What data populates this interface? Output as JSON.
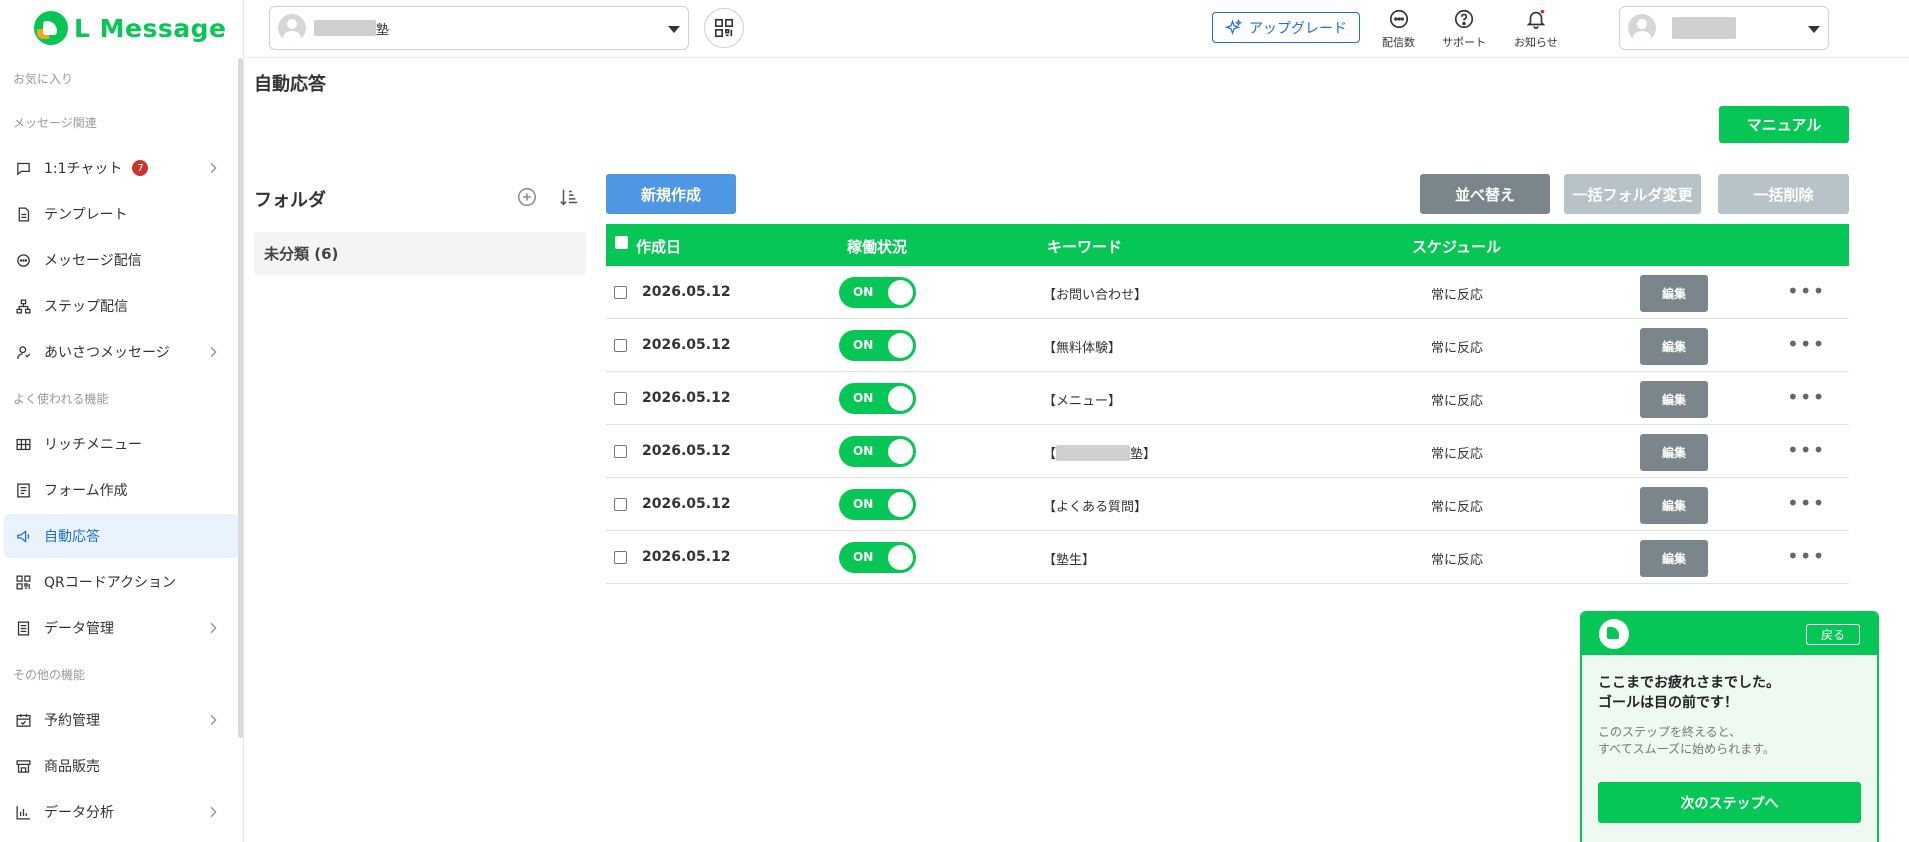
{
  "app": {
    "logo_text": "L Message"
  },
  "sidebar": {
    "sections": {
      "favorites": "お気に入り",
      "message": "メッセージ関連",
      "common": "よく使われる機能",
      "other": "その他の機能"
    },
    "items": {
      "chat": {
        "label": "1:1チャット",
        "badge": "7"
      },
      "template": {
        "label": "テンプレート"
      },
      "broadcast": {
        "label": "メッセージ配信"
      },
      "step": {
        "label": "ステップ配信"
      },
      "greeting": {
        "label": "あいさつメッセージ"
      },
      "richmenu": {
        "label": "リッチメニュー"
      },
      "form": {
        "label": "フォーム作成"
      },
      "autoreply": {
        "label": "自動応答"
      },
      "qr": {
        "label": "QRコードアクション"
      },
      "data": {
        "label": "データ管理"
      },
      "reservation": {
        "label": "予約管理"
      },
      "sales": {
        "label": "商品販売"
      },
      "analytics": {
        "label": "データ分析"
      }
    }
  },
  "header": {
    "account_suffix": "塾",
    "upgrade_label": "アップグレード",
    "icons": {
      "deliveries": "配信数",
      "support": "サポート",
      "notifications": "お知らせ"
    }
  },
  "main": {
    "title": "自動応答",
    "manual_label": "マニュアル",
    "folder": {
      "title": "フォルダ",
      "item_label": "未分類 (6)"
    },
    "toolbar": {
      "new_label": "新規作成",
      "sort_label": "並べ替え",
      "bulk_folder_label": "一括フォルダ変更",
      "bulk_delete_label": "一括削除"
    },
    "table": {
      "headers": {
        "date": "作成日",
        "status": "稼働状況",
        "keyword": "キーワード",
        "schedule": "スケジュール"
      },
      "toggle_on": "ON",
      "edit_label": "編集",
      "rows": [
        {
          "date": "2026.05.12",
          "keyword": "【お問い合わせ】",
          "schedule": "常に反応"
        },
        {
          "date": "2026.05.12",
          "keyword": "【無料体験】",
          "schedule": "常に反応"
        },
        {
          "date": "2026.05.12",
          "keyword": "【メニュー】",
          "schedule": "常に反応"
        },
        {
          "date": "2026.05.12",
          "keyword_prefix": "【",
          "keyword_suffix": "塾】",
          "schedule": "常に反応"
        },
        {
          "date": "2026.05.12",
          "keyword": "【よくある質問】",
          "schedule": "常に反応"
        },
        {
          "date": "2026.05.12",
          "keyword": "【塾生】",
          "schedule": "常に反応"
        }
      ]
    }
  },
  "guide": {
    "back_label": "戻る",
    "title_line1": "ここまでお疲れさまでした。",
    "title_line2": "ゴールは目の前です！",
    "body_line1": "このステップを終えると、",
    "body_line2": "すべてスムーズに始められます。",
    "next_label": "次のステップへ"
  }
}
